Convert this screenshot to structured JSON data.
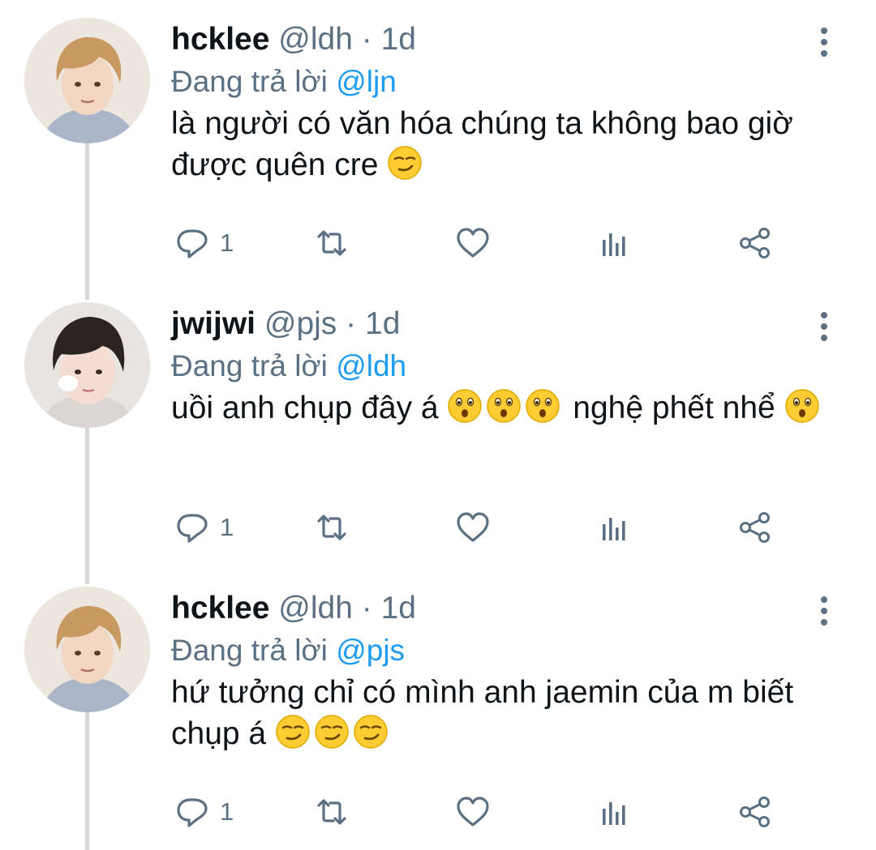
{
  "replying_label": "Đang trả lời",
  "colors": {
    "accent": "#1d9bf0",
    "muted": "#5b7083",
    "thread_line": "#d6d9db"
  },
  "icons": [
    "more-vertical-icon",
    "reply-icon",
    "retweet-icon",
    "like-icon",
    "analytics-icon",
    "share-icon",
    "smirk-emoji",
    "hushed-emoji"
  ],
  "tweets": [
    {
      "display_name": "hcklee",
      "handle": "@ldh",
      "separator": "·",
      "time": "1d",
      "replying_to": "@ljn",
      "text": "là người có văn hóa chúng ta không bao giờ được quên cre",
      "text_emojis": [
        "smirk"
      ],
      "reply_count": "1"
    },
    {
      "display_name": "jwijwi",
      "handle": "@pjs",
      "separator": "·",
      "time": "1d",
      "replying_to": "@ldh",
      "text_part1": "uồi anh chụp đây á",
      "text_part2": "nghệ phết nhể",
      "text_emojis": [
        "hushed",
        "hushed",
        "hushed",
        "hushed"
      ],
      "reply_count": "1"
    },
    {
      "display_name": "hcklee",
      "handle": "@ldh",
      "separator": "·",
      "time": "1d",
      "replying_to": "@pjs",
      "text": "hứ tưởng chỉ có mình anh jaemin của m biết chụp á",
      "text_emojis": [
        "smirk",
        "smirk",
        "smirk"
      ],
      "reply_count": "1"
    }
  ]
}
